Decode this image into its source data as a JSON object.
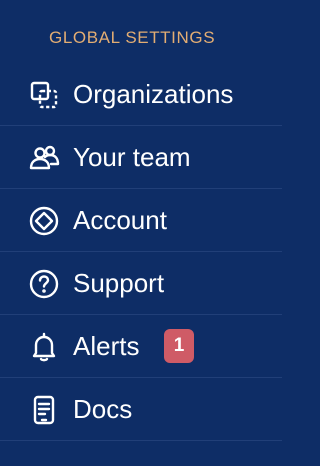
{
  "sidebar": {
    "section_title": "GLOBAL SETTINGS",
    "items": [
      {
        "label": "Organizations",
        "icon": "organizations-icon"
      },
      {
        "label": "Your team",
        "icon": "team-icon"
      },
      {
        "label": "Account",
        "icon": "account-icon"
      },
      {
        "label": "Support",
        "icon": "support-icon"
      },
      {
        "label": "Alerts",
        "icon": "bell-icon",
        "badge": "1"
      },
      {
        "label": "Docs",
        "icon": "docs-icon"
      }
    ]
  },
  "colors": {
    "background": "#0e2d66",
    "section_title": "#e3ad73",
    "badge": "#cf5b66",
    "text": "#ffffff"
  }
}
